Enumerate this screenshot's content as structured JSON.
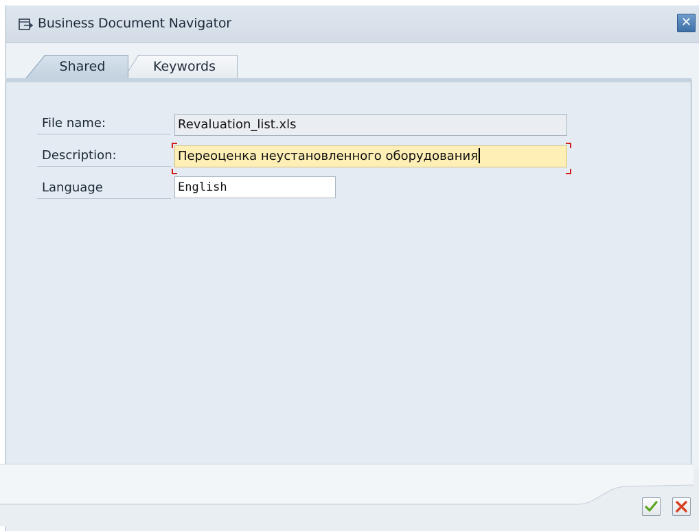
{
  "window": {
    "title": "Business Document Navigator",
    "icon": "external-window-icon",
    "close_icon": "close-icon"
  },
  "tabs": [
    {
      "label": "Shared",
      "active": true
    },
    {
      "label": "Keywords",
      "active": false
    }
  ],
  "form": {
    "file_name": {
      "label": "File name:",
      "value": "Revaluation_list.xls",
      "editable": false
    },
    "description": {
      "label": "Description:",
      "value": "Переоценка неустановленного оборудования",
      "focused": true
    },
    "language": {
      "label": "Language",
      "value": "English"
    }
  },
  "footer": {
    "confirm_icon": "checkmark-icon",
    "cancel_icon": "cancel-x-icon"
  },
  "colors": {
    "focus_field": "#fdefb5",
    "focus_marker": "#d31c1c",
    "confirm": "#5aa521",
    "cancel": "#d7401f",
    "title_close": "#3d6fa6"
  }
}
